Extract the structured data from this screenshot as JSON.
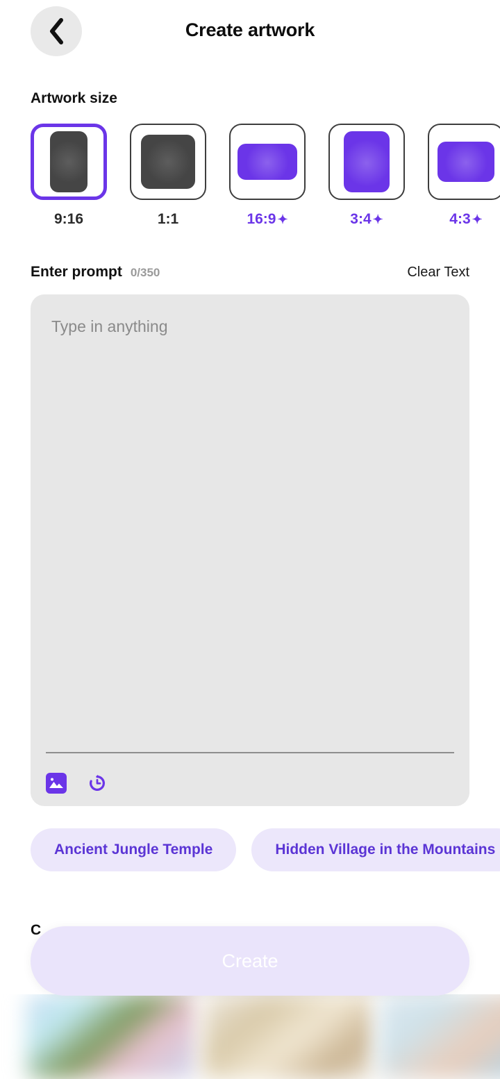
{
  "header": {
    "title": "Create artwork",
    "back_icon": "chevron-left-icon"
  },
  "artwork_size": {
    "label": "Artwork size",
    "options": [
      {
        "label": "9:16",
        "premium": false,
        "selected": true,
        "shape": "portrait-tall",
        "color": "#454545"
      },
      {
        "label": "1:1",
        "premium": false,
        "selected": false,
        "shape": "square",
        "color": "#454545"
      },
      {
        "label": "16:9",
        "premium": true,
        "selected": false,
        "shape": "landscape-wide",
        "color": "#6b35e8"
      },
      {
        "label": "3:4",
        "premium": true,
        "selected": false,
        "shape": "portrait",
        "color": "#6b35e8"
      },
      {
        "label": "4:3",
        "premium": true,
        "selected": false,
        "shape": "landscape",
        "color": "#6b35e8"
      }
    ],
    "premium_badge": "✦"
  },
  "prompt": {
    "title": "Enter prompt",
    "counter": "0/350",
    "clear_label": "Clear Text",
    "placeholder": "Type in anything",
    "value": "",
    "tools": [
      {
        "name": "image-icon",
        "label": "Add image"
      },
      {
        "name": "history-icon",
        "label": "Prompt history"
      }
    ]
  },
  "suggestions": [
    "Ancient Jungle Temple",
    "Hidden Village in the Mountains"
  ],
  "obscured_heading": "C",
  "create_button": {
    "label": "Create",
    "enabled": false
  },
  "colors": {
    "accent": "#6b35e8",
    "chip_bg": "#ece7fb",
    "chip_text": "#5b35d5",
    "prompt_bg": "#e7e7e7",
    "create_bg": "#eae4fb",
    "create_text": "#ffffff",
    "back_bg": "#e9e9e9"
  }
}
